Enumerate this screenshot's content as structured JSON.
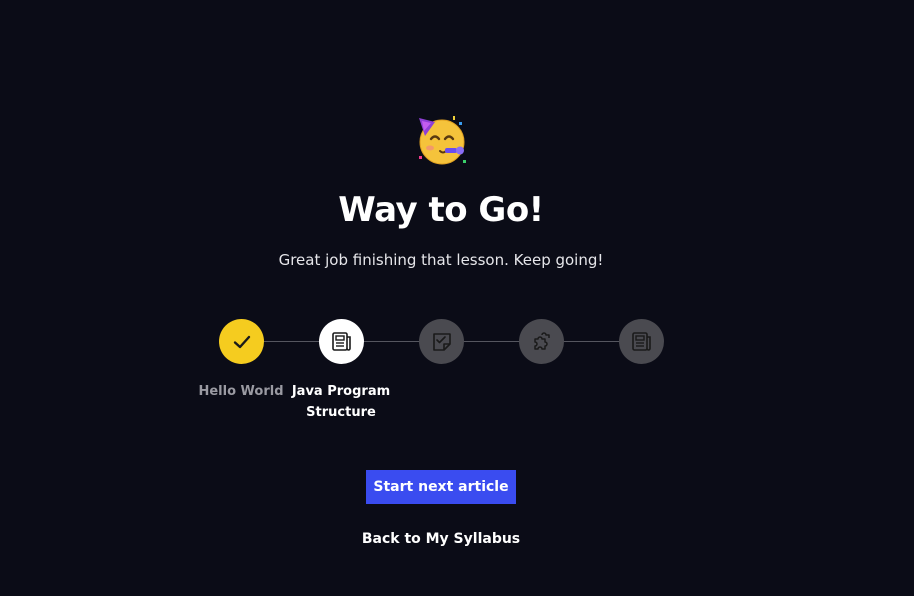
{
  "header": {
    "emoji_icon": "partying-face-icon",
    "title": "Way to Go!",
    "subtitle": "Great job finishing that lesson. Keep going!"
  },
  "progress": {
    "steps": [
      {
        "icon": "checkmark-icon",
        "status": "completed",
        "label": "Hello World"
      },
      {
        "icon": "article-icon",
        "status": "current",
        "label": "Java Program Structure"
      },
      {
        "icon": "quiz-icon",
        "status": "locked",
        "label": ""
      },
      {
        "icon": "puzzle-icon",
        "status": "locked",
        "label": ""
      },
      {
        "icon": "article-icon",
        "status": "locked",
        "label": ""
      }
    ]
  },
  "actions": {
    "primary_label": "Start next article",
    "secondary_label": "Back to My Syllabus"
  },
  "colors": {
    "background": "#0b0c17",
    "completed": "#f5cc1f",
    "current": "#ffffff",
    "locked": "#4a4a50",
    "primary": "#3a4cf0"
  }
}
